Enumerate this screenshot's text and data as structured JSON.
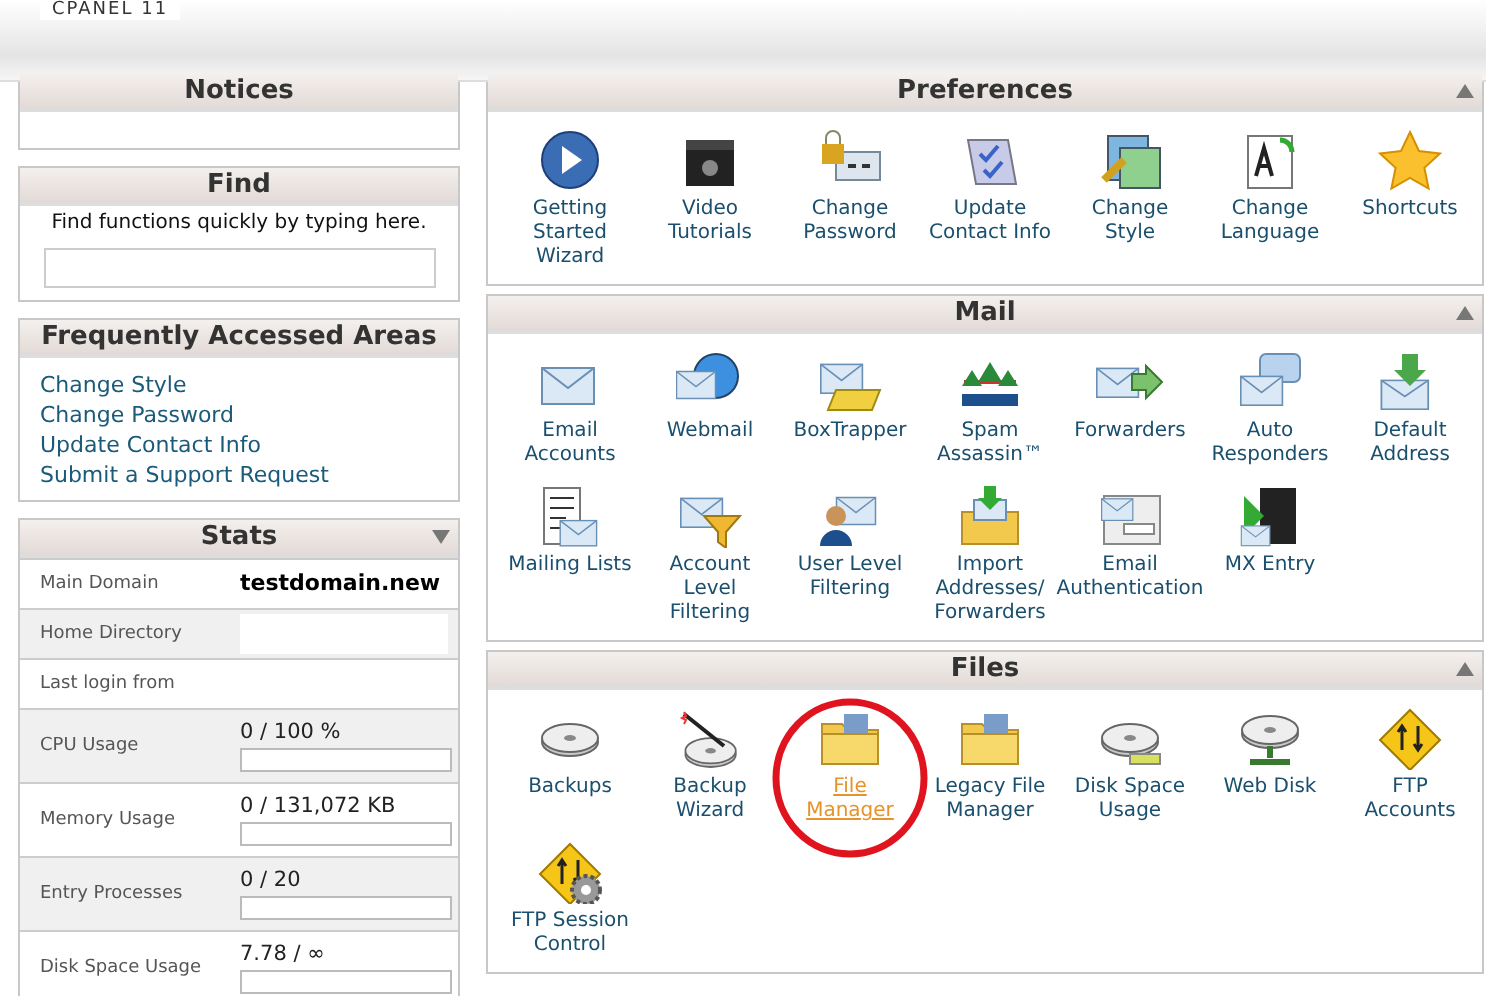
{
  "header": {
    "title": "CPANEL 11"
  },
  "notices": {
    "title": "Notices"
  },
  "find": {
    "title": "Find",
    "hint": "Find functions quickly by typing here."
  },
  "frequent": {
    "title": "Frequently Accessed Areas",
    "links": [
      "Change Style",
      "Change Password",
      "Update Contact Info",
      "Submit a Support Request"
    ]
  },
  "stats": {
    "title": "Stats",
    "rows": [
      {
        "kind": "text",
        "label": "Main Domain",
        "value": "testdomain.new"
      },
      {
        "kind": "hidden",
        "label": "Home Directory"
      },
      {
        "kind": "text",
        "label": "Last login from"
      },
      {
        "kind": "bar",
        "label": "CPU Usage",
        "value": "0 / 100 %",
        "level": 0
      },
      {
        "kind": "bar",
        "label": "Memory Usage",
        "value": "0 / 131,072 KB",
        "level": 0
      },
      {
        "kind": "bar",
        "label": "Entry Processes",
        "value": "0 / 20",
        "level": 0
      },
      {
        "kind": "bar",
        "label": "Disk Space Usage",
        "value": "7.78 / ∞",
        "level": 0
      }
    ]
  },
  "sections": [
    {
      "title": "Preferences",
      "items": [
        {
          "label": "Getting Started Wizard",
          "selected": false
        },
        {
          "label": "Video Tutorials",
          "selected": false
        },
        {
          "label": "Change Password",
          "selected": false
        },
        {
          "label": "Update Contact Info",
          "selected": false
        },
        {
          "label": "Change Style",
          "selected": false
        },
        {
          "label": "Change Language",
          "selected": false
        },
        {
          "label": "Shortcuts",
          "selected": false
        }
      ]
    },
    {
      "title": "Mail",
      "items": [
        {
          "label": "Email Accounts",
          "selected": false
        },
        {
          "label": "Webmail",
          "selected": false
        },
        {
          "label": "BoxTrapper",
          "selected": false
        },
        {
          "label": "Spam Assassin™",
          "selected": false
        },
        {
          "label": "Forwarders",
          "selected": false
        },
        {
          "label": "Auto Responders",
          "selected": false
        },
        {
          "label": "Default Address",
          "selected": false
        },
        {
          "label": "Mailing Lists",
          "selected": false
        },
        {
          "label": "Account Level Filtering",
          "selected": false
        },
        {
          "label": "User Level Filtering",
          "selected": false
        },
        {
          "label": "Import Addresses/ Forwarders",
          "selected": false
        },
        {
          "label": "Email Authentication",
          "selected": false
        },
        {
          "label": "MX Entry",
          "selected": false
        }
      ]
    },
    {
      "title": "Files",
      "items": [
        {
          "label": "Backups",
          "selected": false
        },
        {
          "label": "Backup Wizard",
          "selected": false
        },
        {
          "label": "File Manager",
          "selected": true
        },
        {
          "label": "Legacy File Manager",
          "selected": false
        },
        {
          "label": "Disk Space Usage",
          "selected": false
        },
        {
          "label": "Web Disk",
          "selected": false
        },
        {
          "label": "FTP Accounts",
          "selected": false
        },
        {
          "label": "FTP Session Control",
          "selected": false
        }
      ]
    }
  ]
}
